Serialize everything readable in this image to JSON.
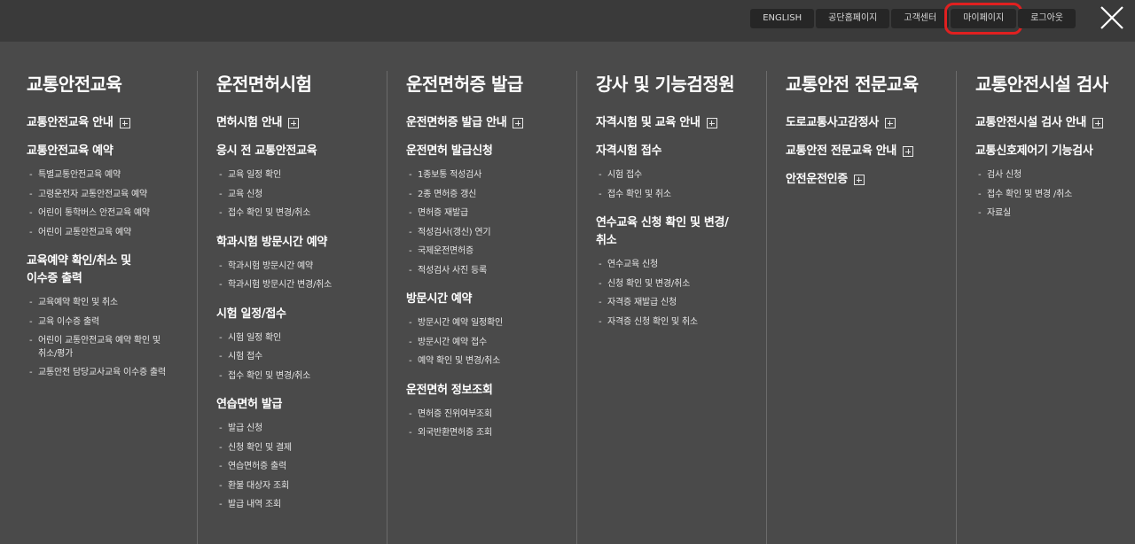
{
  "top_links": [
    "ENGLISH",
    "공단홈페이지",
    "고객센터",
    "마이페이지",
    "로그아웃"
  ],
  "columns": [
    {
      "title": "교통안전교육",
      "groups": [
        {
          "title": "교통안전교육 안내",
          "plus": true,
          "items": []
        },
        {
          "title": "교통안전교육 예약",
          "plus": false,
          "items": [
            "특별교통안전교육 예약",
            "고령운전자 교통안전교육 예약",
            "어린이 통학버스 안전교육 예약",
            "어린이 교통안전교육 예약"
          ]
        },
        {
          "title": "교육예약 확인/취소 및\n이수증 출력",
          "plus": false,
          "items": [
            "교육예약 확인 및 취소",
            "교육 이수증 출력",
            "어린이 교통안전교육 예약 확인 및\n취소/평가",
            "교통안전 담당교사교육 이수증 출력"
          ]
        }
      ]
    },
    {
      "title": "운전면허시험",
      "groups": [
        {
          "title": "면허시험 안내",
          "plus": true,
          "items": []
        },
        {
          "title": "응시 전 교통안전교육",
          "plus": false,
          "items": [
            "교육 일정 확인",
            "교육 신청",
            "접수 확인 및 변경/취소"
          ]
        },
        {
          "title": "학과시험 방문시간 예약",
          "plus": false,
          "items": [
            "학과시험 방문시간 예약",
            "학과시험 방문시간 변경/취소"
          ]
        },
        {
          "title": "시험 일정/접수",
          "plus": false,
          "items": [
            "시험 일정 확인",
            "시험 접수",
            "접수 확인 및 변경/취소"
          ]
        },
        {
          "title": "연습면허 발급",
          "plus": false,
          "items": [
            "발급 신청",
            "신청 확인 및 결제",
            "연습면허증 출력",
            "환불 대상자 조회",
            "발급 내역 조회"
          ]
        }
      ]
    },
    {
      "title": "운전면허증 발급",
      "groups": [
        {
          "title": "운전면허증 발급 안내",
          "plus": true,
          "items": []
        },
        {
          "title": "운전면허 발급신청",
          "plus": false,
          "items": [
            "1종보통 적성검사",
            "2종 면허증 갱신",
            "면허증 재발급",
            "적성검사(갱신) 연기",
            "국제운전면허증",
            "적성검사 사진 등록"
          ]
        },
        {
          "title": "방문시간 예약",
          "plus": false,
          "items": [
            "방문시간 예약 일정확인",
            "방문시간 예약 접수",
            "예약 확인 및 변경/취소"
          ]
        },
        {
          "title": "운전면허 정보조회",
          "plus": false,
          "items": [
            "면허증 진위여부조회",
            "외국반환면허증 조회"
          ]
        }
      ]
    },
    {
      "title": "강사 및 기능검정원",
      "groups": [
        {
          "title": "자격시험 및 교육 안내",
          "plus": true,
          "items": []
        },
        {
          "title": "자격시험 접수",
          "plus": false,
          "items": [
            "시험 접수",
            "접수 확인 및 취소"
          ]
        },
        {
          "title": "연수교육 신청 확인 및 변경/\n취소",
          "plus": false,
          "items": [
            "연수교육 신청",
            "신청 확인 및 변경/취소",
            "자격증 재발급 신청",
            "자격증 신청 확인 및 취소"
          ]
        }
      ]
    },
    {
      "title": "교통안전 전문교육",
      "groups": [
        {
          "title": "도로교통사고감정사",
          "plus": true,
          "items": []
        },
        {
          "title": "교통안전 전문교육 안내",
          "plus": true,
          "items": []
        },
        {
          "title": "안전운전인증",
          "plus": true,
          "items": []
        }
      ]
    },
    {
      "title": "교통안전시설 검사",
      "groups": [
        {
          "title": "교통안전시설 검사 안내",
          "plus": true,
          "items": []
        },
        {
          "title": "교통신호제어기 기능검사",
          "plus": false,
          "items": [
            "검사 신청",
            "접수 확인 및 변경 /취소",
            "자료실"
          ]
        }
      ]
    }
  ]
}
